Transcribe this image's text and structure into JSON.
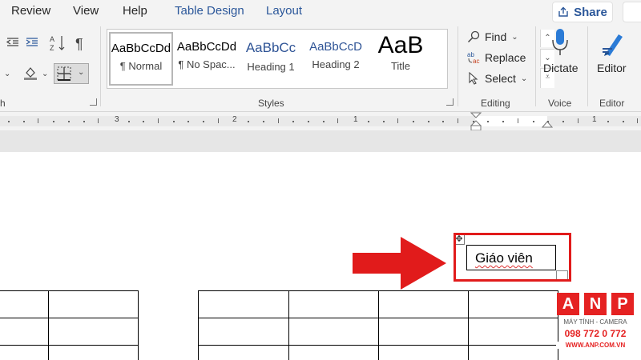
{
  "tabs": [
    {
      "label": "Review"
    },
    {
      "label": "View"
    },
    {
      "label": "Help"
    },
    {
      "label": "Table Design"
    },
    {
      "label": "Layout"
    }
  ],
  "share_label": "Share",
  "ribbon": {
    "paragraph_group_label": "h",
    "styles": [
      {
        "sample": "AaBbCcDd",
        "name": "¶ Normal"
      },
      {
        "sample": "AaBbCcDd",
        "name": "¶ No Spac..."
      },
      {
        "sample": "AaBbCc",
        "name": "Heading 1"
      },
      {
        "sample": "AaBbCcD",
        "name": "Heading 2"
      },
      {
        "sample": "AaB",
        "name": "Title"
      }
    ],
    "styles_group_label": "Styles",
    "editing": {
      "find": "Find",
      "replace": "Replace",
      "select": "Select",
      "group_label": "Editing"
    },
    "dictate_label": "Dictate",
    "voice_group_label": "Voice",
    "editor_label": "Editor",
    "editor_group_label": "Editor"
  },
  "ruler": {
    "numbers": [
      "3",
      "2",
      "1",
      "1"
    ]
  },
  "document": {
    "textbox_text": "Giáo viên",
    "left_table": {
      "rows": 3,
      "cols": 2
    },
    "right_table": {
      "rows": 3,
      "cols": 4
    }
  },
  "annotation": {
    "arrow_color": "#e11b1b",
    "highlight_color": "#e11b1b"
  },
  "watermark": {
    "letters": [
      "A",
      "N",
      "P"
    ],
    "tagline": "MÁY TÍNH - CAMERA",
    "phone": "098 772 0 772",
    "url": "WWW.ANP.COM.VN"
  }
}
